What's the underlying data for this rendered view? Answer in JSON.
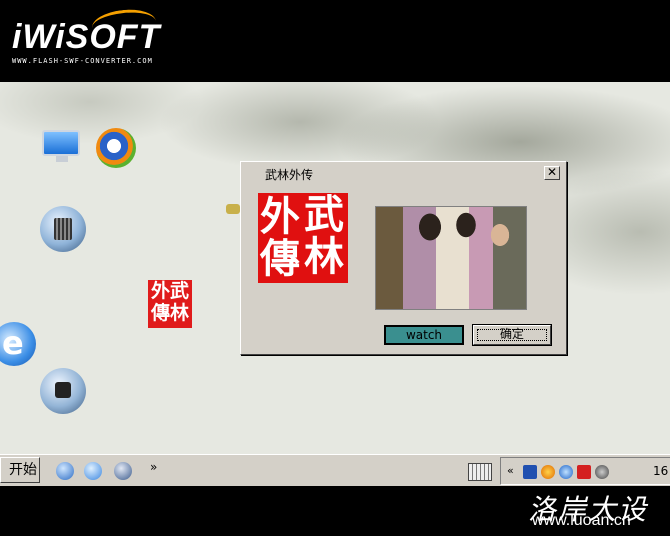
{
  "banner": {
    "logo": "iWiSOFT",
    "url": "WWW.FLASH-SWF-CONVERTER.COM",
    "accent_color": "#f5a000"
  },
  "desktop": {
    "icons": [
      "monitor-icon",
      "media-player-icon",
      "recycle-bin-icon",
      "seal-shortcut-icon",
      "internet-explorer-icon",
      "mac-drive-icon"
    ],
    "seal_small_chars": [
      "外",
      "武",
      "傳",
      "林"
    ]
  },
  "dialog": {
    "title": "武林外传",
    "close_label": "✕",
    "seal_chars": [
      "武",
      "林",
      "外",
      "傳"
    ],
    "seal_color": "#e01010",
    "watch_label": "watch",
    "ok_label": "确定",
    "watch_color": "#3a8f8f"
  },
  "taskbar": {
    "start_label": "开始",
    "quicklaunch_chevron": "»",
    "tray_chevron": "«",
    "clock": "16"
  },
  "footer": {
    "brand_cn": "洛岸大设",
    "brand_url": "www.luoan.cn"
  }
}
